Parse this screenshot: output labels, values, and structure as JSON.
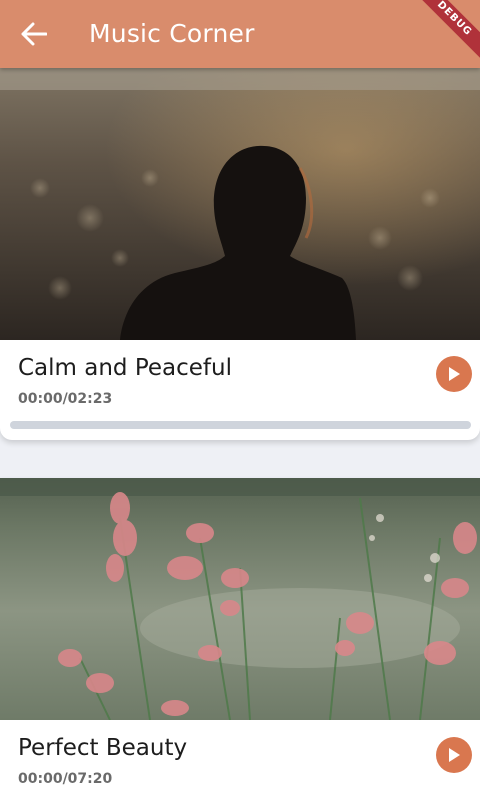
{
  "app_bar": {
    "title": "Music Corner",
    "back_icon": "arrow-back-icon",
    "background_color": "#d98c6c",
    "debug_banner": "DEBUG"
  },
  "tracks": [
    {
      "title": "Calm and Peaceful",
      "time": "00:00/02:23",
      "progress": 0,
      "image": "woman-silhouette-sunset-photo",
      "play_icon": "play-icon"
    },
    {
      "title": "Perfect Beauty",
      "time": "00:00/07:20",
      "progress": 0,
      "image": "pink-wildflowers-meadow-photo",
      "play_icon": "play-icon"
    }
  ],
  "colors": {
    "accent": "#d9774f",
    "progress_track": "#cfd4dc",
    "background": "#eef0f5"
  }
}
